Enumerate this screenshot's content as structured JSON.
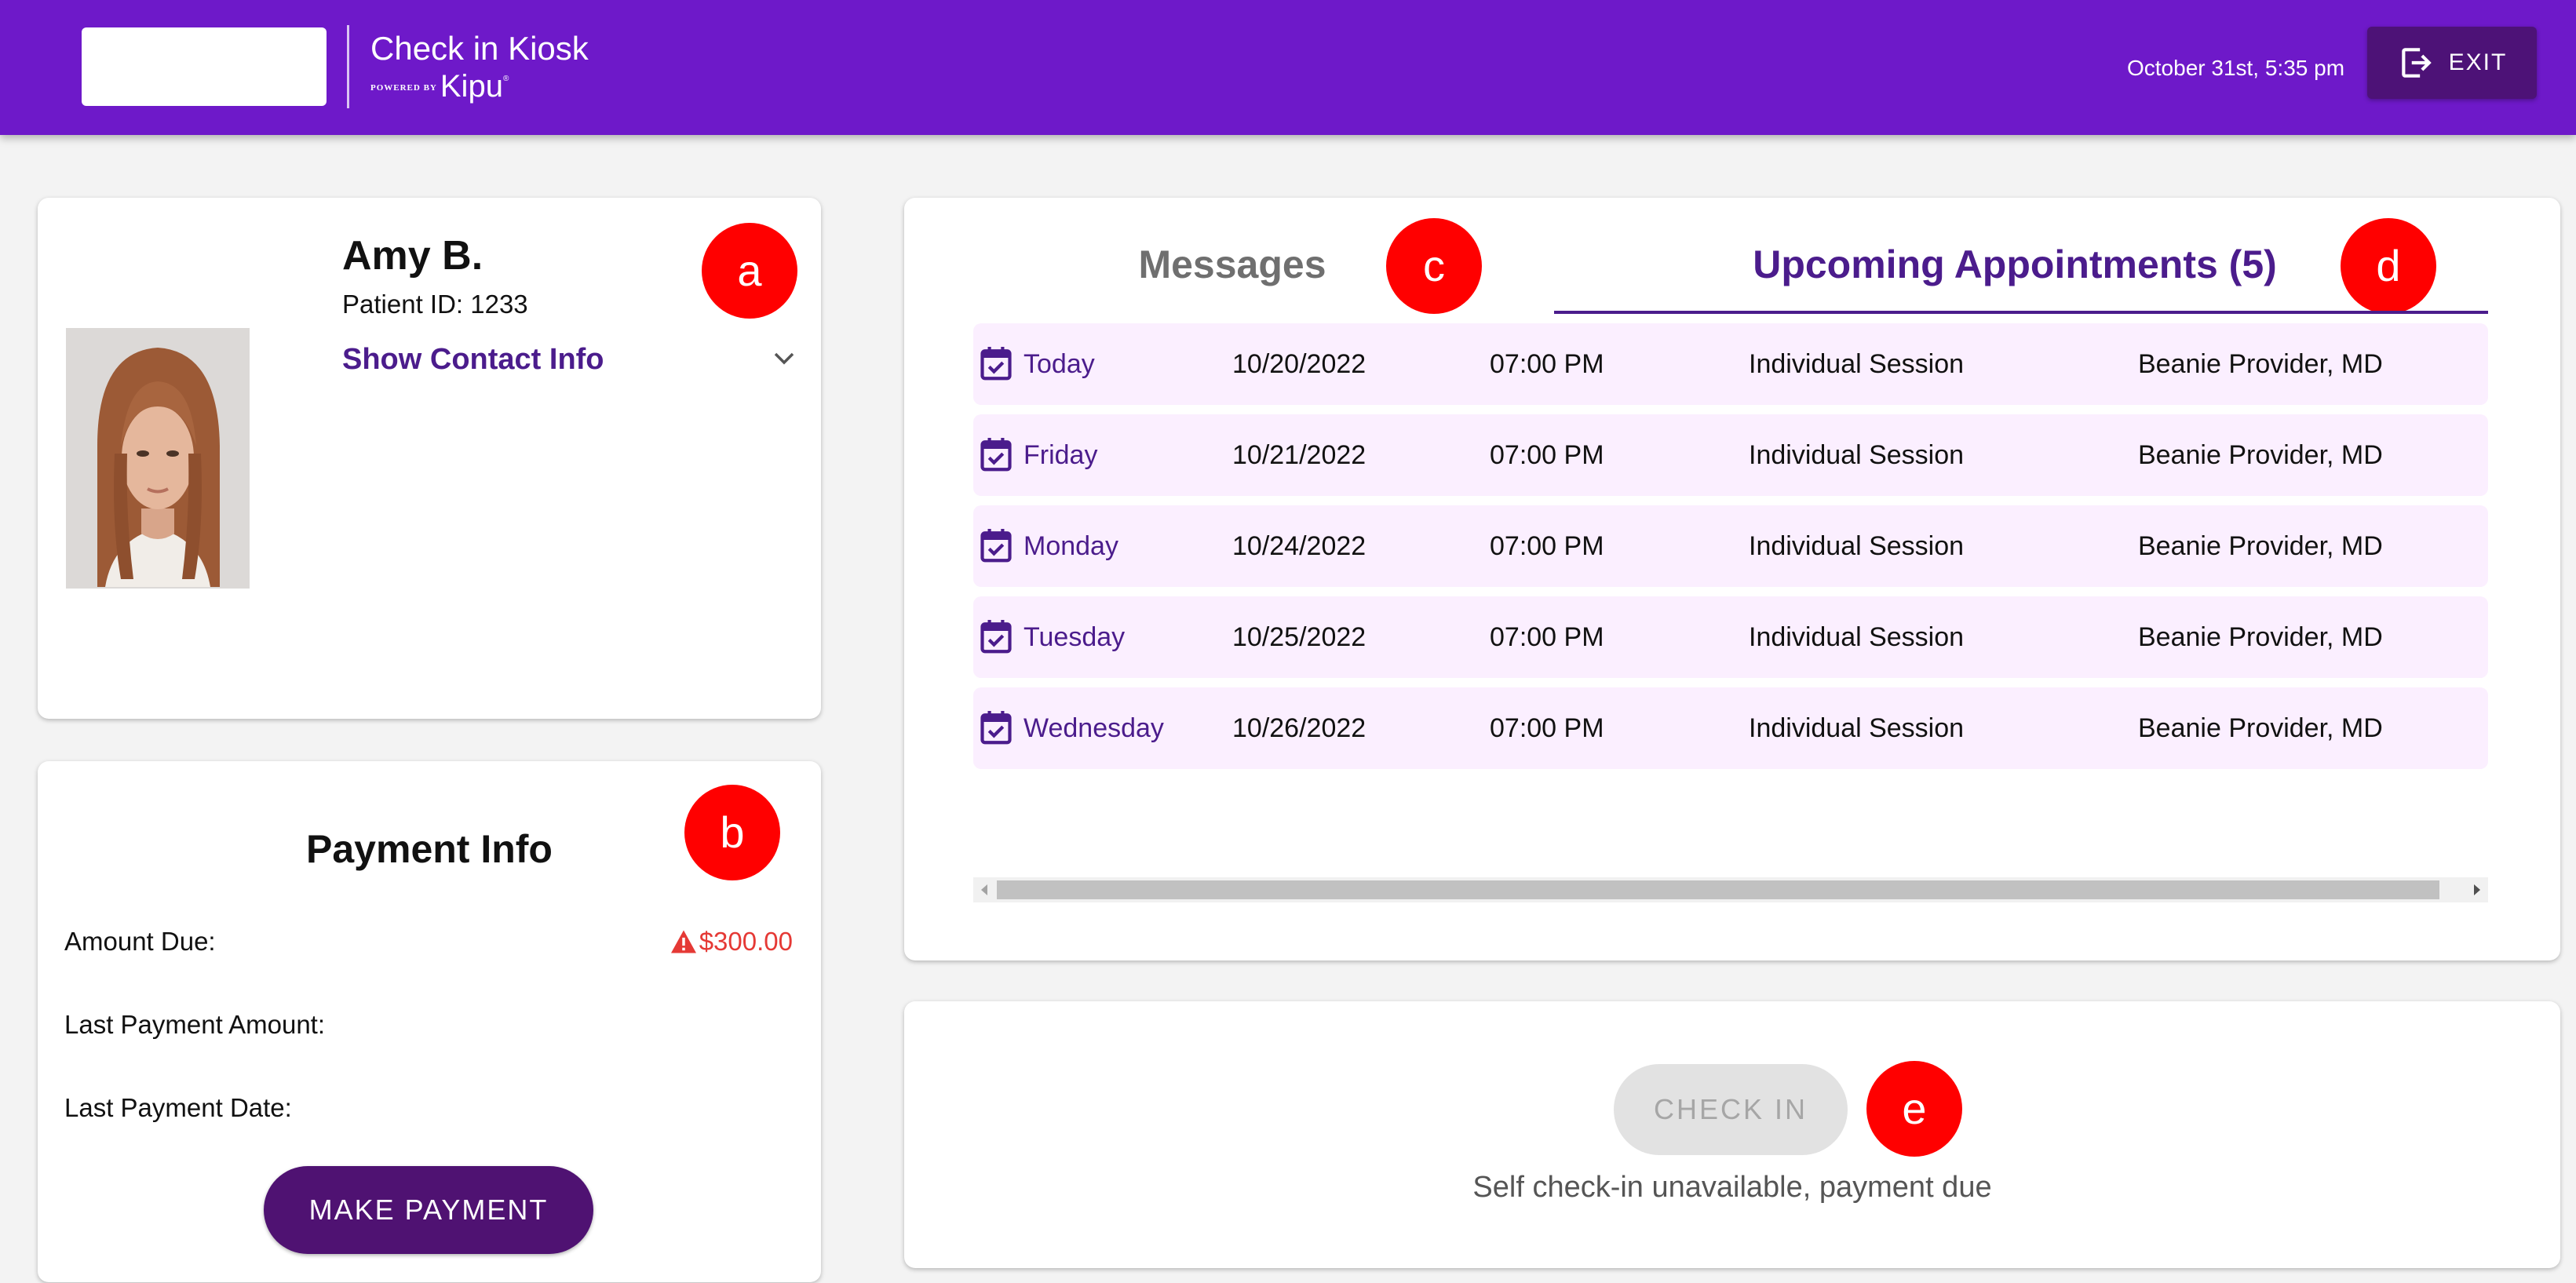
{
  "header": {
    "title": "Check in Kiosk",
    "powered_by": "POWERED BY",
    "brand": "Kipu",
    "brand_mark": "®",
    "datetime": "October 31st, 5:35 pm",
    "exit_label": "EXIT",
    "background_color": "#6e19c9",
    "exit_color": "#4d1277"
  },
  "patient": {
    "name": "Amy B.",
    "patient_id": "Patient ID: 1233",
    "contact_toggle": "Show Contact Info",
    "badge": "a"
  },
  "payment": {
    "title": "Payment Info",
    "badge": "b",
    "amount_due_label": "Amount Due:",
    "amount_due_value": "$300.00",
    "last_amount_label": "Last Payment Amount:",
    "last_date_label": "Last Payment Date:",
    "button_label": "MAKE PAYMENT",
    "warning_color": "#e53935"
  },
  "appointments": {
    "tabs": [
      {
        "label": "Messages",
        "badge": "c",
        "active": false
      },
      {
        "label": "Upcoming Appointments (5)",
        "badge": "d",
        "active": true
      }
    ],
    "rows": [
      {
        "day": "Today",
        "date": "10/20/2022",
        "time": "07:00 PM",
        "type": "Individual Session",
        "provider": "Beanie Provider, MD"
      },
      {
        "day": "Friday",
        "date": "10/21/2022",
        "time": "07:00 PM",
        "type": "Individual Session",
        "provider": "Beanie Provider, MD"
      },
      {
        "day": "Monday",
        "date": "10/24/2022",
        "time": "07:00 PM",
        "type": "Individual Session",
        "provider": "Beanie Provider, MD"
      },
      {
        "day": "Tuesday",
        "date": "10/25/2022",
        "time": "07:00 PM",
        "type": "Individual Session",
        "provider": "Beanie Provider, MD"
      },
      {
        "day": "Wednesday",
        "date": "10/26/2022",
        "time": "07:00 PM",
        "type": "Individual Session",
        "provider": "Beanie Provider, MD"
      }
    ],
    "row_icon": "calendar-check-icon",
    "accent_color": "#4b1c8c"
  },
  "checkin": {
    "button_label": "CHECK IN",
    "badge": "e",
    "note": "Self check-in unavailable, payment due",
    "disabled": true
  },
  "annotation_badge_color": "#ff0000"
}
